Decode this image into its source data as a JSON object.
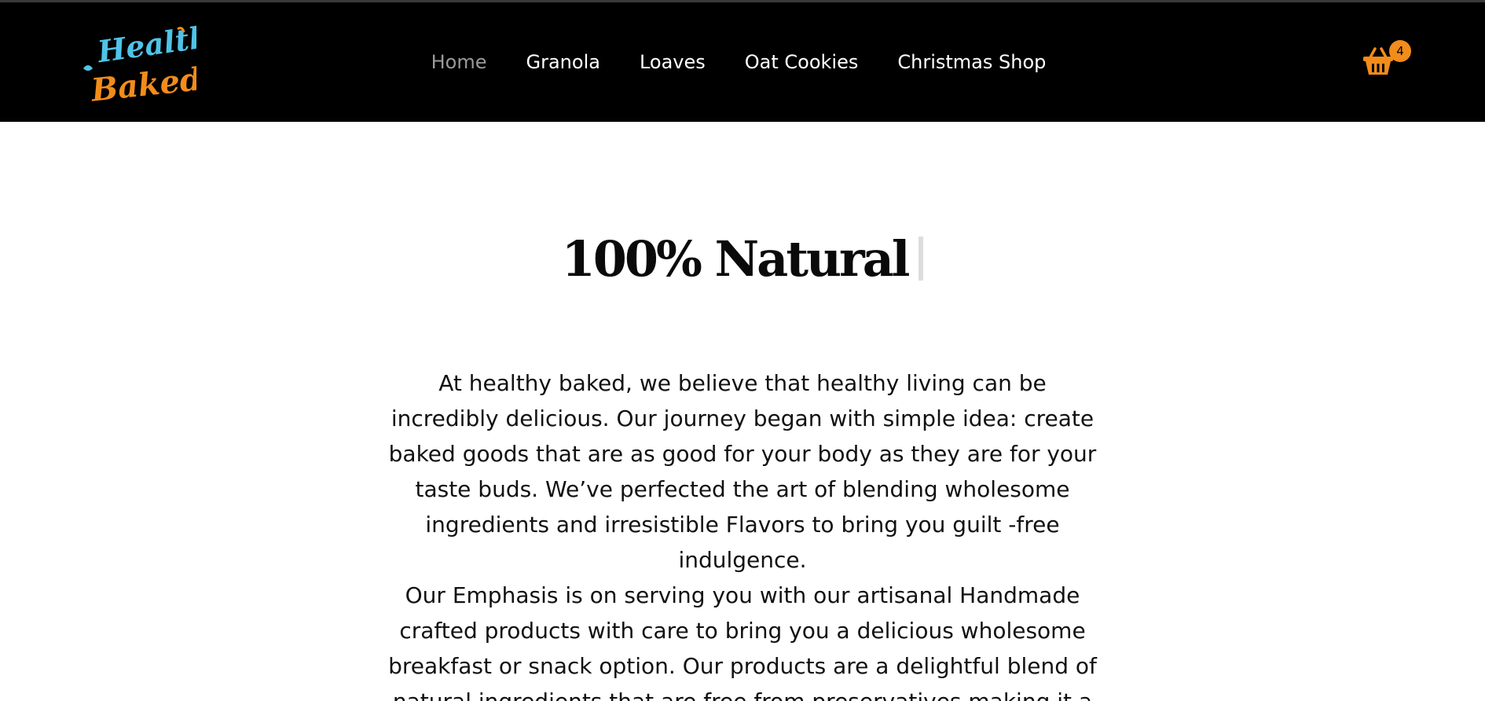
{
  "brand": {
    "logo_word1": "Healthy",
    "logo_word2": "Baked",
    "colors": {
      "logo_primary": "#4fc3e8",
      "logo_secondary": "#f28c1b",
      "header_bg": "#000000",
      "nav_active": "#9a9a9a",
      "nav_default": "#ffffff",
      "accent": "#f28c1b"
    }
  },
  "nav": {
    "items": [
      {
        "label": "Home",
        "active": true
      },
      {
        "label": "Granola",
        "active": false
      },
      {
        "label": "Loaves",
        "active": false
      },
      {
        "label": "Oat Cookies",
        "active": false
      },
      {
        "label": "Christmas Shop",
        "active": false
      }
    ]
  },
  "cart": {
    "icon": "basket-icon",
    "count": "4"
  },
  "hero": {
    "title": "100% Natural"
  },
  "content": {
    "paragraph1": "At healthy baked, we believe that healthy living can be incredibly delicious. Our journey began with simple idea: create baked goods that are as good for your body as they are for your taste buds. We’ve perfected the art of blending wholesome ingredients and irresistible Flavors to bring you guilt -free indulgence.",
    "paragraph2": "Our Emphasis is on serving you with our artisanal Handmade crafted products with care to bring you a delicious wholesome breakfast or snack option. Our products are a delightful blend of natural ingredients that are free from preservatives making it a"
  }
}
